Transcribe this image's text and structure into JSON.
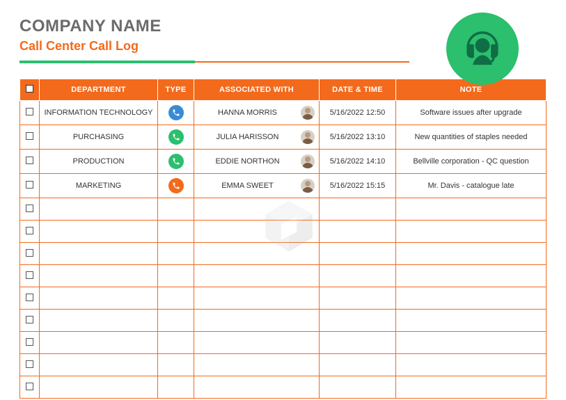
{
  "header": {
    "company": "COMPANY NAME",
    "subtitle": "Call Center Call Log"
  },
  "columns": {
    "checkbox": "",
    "department": "DEPARTMENT",
    "type": "TYPE",
    "associated": "ASSOCIATED WITH",
    "datetime": "DATE & TIME",
    "note": "NOTE"
  },
  "rows": [
    {
      "department": "INFORMATION TECHNOLOGY",
      "type_color": "blue",
      "associated": "HANNA MORRIS",
      "datetime": "5/16/2022 12:50",
      "note": "Software issues after upgrade"
    },
    {
      "department": "PURCHASING",
      "type_color": "green",
      "associated": "JULIA HARISSON",
      "datetime": "5/16/2022 13:10",
      "note": "New quantities of staples needed"
    },
    {
      "department": "PRODUCTION",
      "type_color": "green",
      "associated": "EDDIE NORTHON",
      "datetime": "5/16/2022 14:10",
      "note": "Bellville corporation - QC question"
    },
    {
      "department": "MARKETING",
      "type_color": "orange",
      "associated": "EMMA SWEET",
      "datetime": "5/16/2022 15:15",
      "note": "Mr. Davis - catalogue late"
    }
  ],
  "empty_rows": 9
}
